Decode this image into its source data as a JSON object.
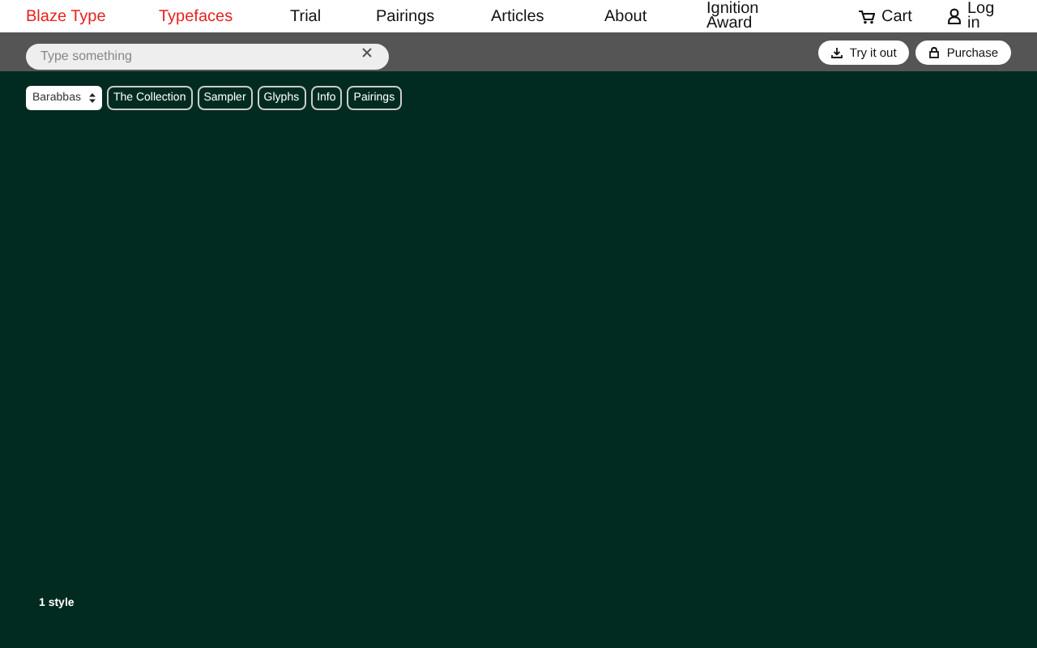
{
  "brand": "Blaze Type",
  "nav": [
    {
      "label": "Typefaces",
      "selected": true
    },
    {
      "label": "Trial",
      "selected": false
    },
    {
      "label": "Pairings",
      "selected": false
    },
    {
      "label": "Articles",
      "selected": false
    },
    {
      "label": "About",
      "selected": false
    },
    {
      "label": "Ignition Award",
      "selected": false
    }
  ],
  "cart": "Cart",
  "login": "Log in",
  "search": {
    "placeholder": "Type something"
  },
  "actions": [
    {
      "label": "Try it out",
      "kind": "download"
    },
    {
      "label": "Purchase",
      "kind": "lock"
    }
  ],
  "font_select": "Barabbas",
  "subnav": [
    "The Collection",
    "Sampler",
    "Glyphs",
    "Info",
    "Pairings"
  ],
  "styles_count": "1 style"
}
